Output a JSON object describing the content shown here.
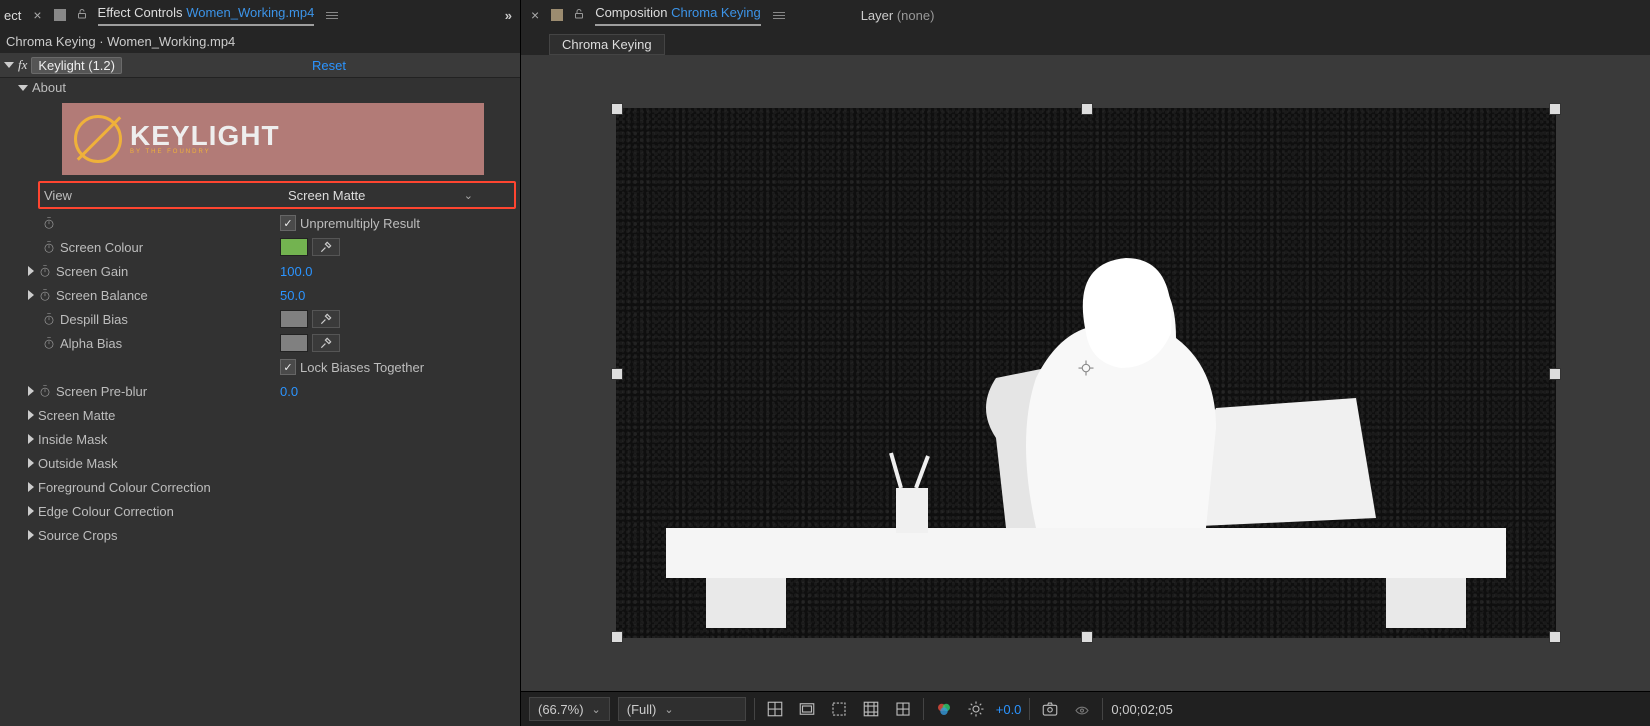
{
  "left_panel": {
    "tab_prefix": "ect",
    "tab_title_prefix": "Effect Controls",
    "tab_title_file": "Women_Working.mp4",
    "breadcrumb": "Chroma Keying · Women_Working.mp4",
    "effect_name": "Keylight (1.2)",
    "reset_label": "Reset",
    "about_label": "About",
    "logo_text": "KEYLIGHT",
    "logo_sub": "BY THE FOUNDRY",
    "view_label": "View",
    "view_value": "Screen Matte",
    "unpremult_label": "Unpremultiply Result",
    "unpremult_checked": true,
    "screen_colour_label": "Screen Colour",
    "screen_colour_value": "#73b350",
    "screen_gain_label": "Screen Gain",
    "screen_gain_value": "100.0",
    "screen_balance_label": "Screen Balance",
    "screen_balance_value": "50.0",
    "despill_label": "Despill Bias",
    "alpha_bias_label": "Alpha Bias",
    "lock_biases_label": "Lock Biases Together",
    "lock_biases_checked": true,
    "screen_preblur_label": "Screen Pre-blur",
    "screen_preblur_value": "0.0",
    "groups": [
      "Screen Matte",
      "Inside Mask",
      "Outside Mask",
      "Foreground Colour Correction",
      "Edge Colour Correction",
      "Source Crops"
    ]
  },
  "right_panel": {
    "tab_title_prefix": "Composition",
    "tab_title_name": "Chroma Keying",
    "layer_label": "Layer",
    "layer_value": "(none)",
    "chip": "Chroma Keying"
  },
  "bottombar": {
    "zoom": "(66.7%)",
    "res": "(Full)",
    "exposure": "+0.0",
    "timecode": "0;00;02;05"
  }
}
